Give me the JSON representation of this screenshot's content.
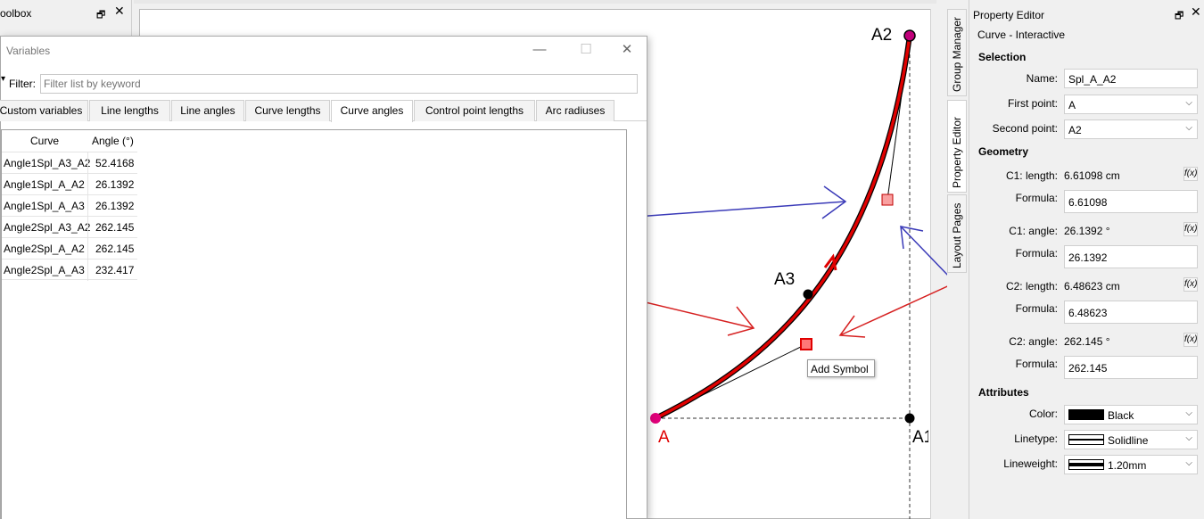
{
  "toolbox": {
    "title": "oolbox",
    "float_icon": "float-icon",
    "close_icon": "close-icon"
  },
  "variables": {
    "title": "Variables",
    "filter_label": "Filter:",
    "filter_placeholder": "Filter list by keyword",
    "tabs": [
      "Custom variables",
      "Line lengths",
      "Line angles",
      "Curve lengths",
      "Curve angles",
      "Control point lengths",
      "Arc radiuses"
    ],
    "active_tab": "Curve angles",
    "columns": [
      "Curve",
      "Angle (°)"
    ],
    "rows": [
      {
        "curve": "Angle1Spl_A3_A2",
        "angle": "52.4168"
      },
      {
        "curve": "Angle1Spl_A_A2",
        "angle": "26.1392"
      },
      {
        "curve": "Angle1Spl_A_A3",
        "angle": "26.1392"
      },
      {
        "curve": "Angle2Spl_A3_A2",
        "angle": "262.145"
      },
      {
        "curve": "Angle2Spl_A_A2",
        "angle": "262.145"
      },
      {
        "curve": "Angle2Spl_A_A3",
        "angle": "232.417"
      }
    ]
  },
  "canvas": {
    "labels": {
      "a": "A",
      "a1": "A1",
      "a2": "A2",
      "a3": "A3"
    },
    "tooltip": "Add Symbol"
  },
  "side_tabs": [
    "Group Manager",
    "Property Editor",
    "Layout Pages"
  ],
  "property_editor": {
    "title": "Property Editor",
    "subtitle": "Curve - Interactive",
    "selection_header": "Selection",
    "name_label": "Name:",
    "name_value": "Spl_A_A2",
    "first_point_label": "First point:",
    "first_point_value": "A",
    "second_point_label": "Second point:",
    "second_point_value": "A2",
    "geometry_header": "Geometry",
    "c1_length_label": "C1: length:",
    "c1_length_value": "6.61098 cm",
    "c1_length_formula_label": "Formula:",
    "c1_length_formula": "6.61098",
    "c1_angle_label": "C1: angle:",
    "c1_angle_value": "26.1392 °",
    "c1_angle_formula_label": "Formula:",
    "c1_angle_formula": "26.1392",
    "c2_length_label": "C2: length:",
    "c2_length_value": "6.48623 cm",
    "c2_length_formula_label": "Formula:",
    "c2_length_formula": "6.48623",
    "c2_angle_label": "C2: angle:",
    "c2_angle_value": "262.145 °",
    "c2_angle_formula_label": "Formula:",
    "c2_angle_formula": "262.145",
    "fx_label": "f(x)",
    "attributes_header": "Attributes",
    "color_label": "Color:",
    "color_value": "Black",
    "linetype_label": "Linetype:",
    "linetype_value": "Solidline",
    "lineweight_label": "Lineweight:",
    "lineweight_value": "1.20mm"
  },
  "colors": {
    "curve": "#e00000",
    "point": "#000000",
    "highlight_red": "#d62020",
    "highlight_blue": "#3a3ab8"
  }
}
